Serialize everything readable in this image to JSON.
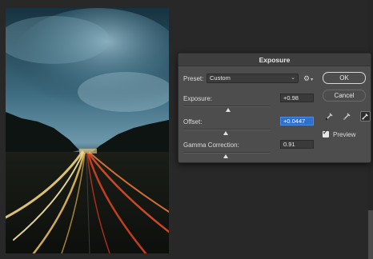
{
  "dialog": {
    "title": "Exposure",
    "preset_label": "Preset:",
    "preset_value": "Custom",
    "exposure": {
      "label": "Exposure:",
      "value": "+0.98",
      "slider_fraction": 0.52
    },
    "offset": {
      "label": "Offset:",
      "value": "+0.0447",
      "slider_fraction": 0.49
    },
    "gamma": {
      "label": "Gamma Correction:",
      "value": "0.91",
      "slider_fraction": 0.49
    },
    "ok_label": "OK",
    "cancel_label": "Cancel",
    "preview_label": "Preview",
    "preview_checked": true,
    "preset_options_icon": "gear-icon",
    "eyedroppers": [
      "eyedropper-black-icon",
      "eyedropper-gray-icon",
      "eyedropper-white-icon"
    ]
  },
  "colors": {
    "dialog_bg": "#4d4d4d",
    "titlebar_bg": "#3e3e3e",
    "active_field": "#2f6fce",
    "workspace_bg": "#282828"
  }
}
